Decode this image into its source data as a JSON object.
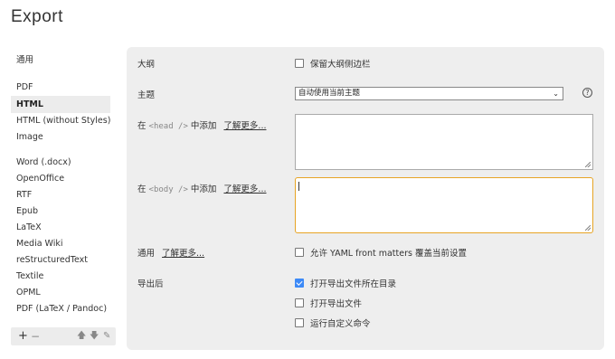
{
  "window": {
    "title": "Export"
  },
  "sidebar": {
    "items": [
      {
        "label": "通用",
        "active": false
      },
      {
        "label": "PDF",
        "active": false
      },
      {
        "label": "HTML",
        "active": true
      },
      {
        "label": "HTML (without Styles)",
        "active": false
      },
      {
        "label": "Image",
        "active": false
      },
      {
        "label": "Word (.docx)",
        "active": false
      },
      {
        "label": "OpenOffice",
        "active": false
      },
      {
        "label": "RTF",
        "active": false
      },
      {
        "label": "Epub",
        "active": false
      },
      {
        "label": "LaTeX",
        "active": false
      },
      {
        "label": "Media Wiki",
        "active": false
      },
      {
        "label": "reStructuredText",
        "active": false
      },
      {
        "label": "Textile",
        "active": false
      },
      {
        "label": "OPML",
        "active": false
      },
      {
        "label": "PDF (LaTeX / Pandoc)",
        "active": false
      }
    ],
    "footer": {
      "add": "+",
      "remove": "−",
      "up": "🡅",
      "down": "🡇",
      "edit": "✎"
    }
  },
  "settings": {
    "outline": {
      "label": "大纲",
      "checkbox_label": "保留大纲侧边栏",
      "checked": false
    },
    "theme": {
      "label": "主题",
      "selected": "自动使用当前主题",
      "help": "?"
    },
    "head": {
      "prefix": "在 ",
      "code": "<head />",
      "suffix": " 中添加",
      "link": "了解更多..."
    },
    "body": {
      "prefix": "在 ",
      "code": "<body />",
      "suffix": " 中添加",
      "link": "了解更多..."
    },
    "general": {
      "label": "通用",
      "link": "了解更多...",
      "checkbox_label": "允许 YAML front matters 覆盖当前设置",
      "checked": false
    },
    "after_export": {
      "label": "导出后",
      "options": [
        {
          "label": "打开导出文件所在目录",
          "checked": true
        },
        {
          "label": "打开导出文件",
          "checked": false
        },
        {
          "label": "运行自定义命令",
          "checked": false
        }
      ]
    }
  }
}
